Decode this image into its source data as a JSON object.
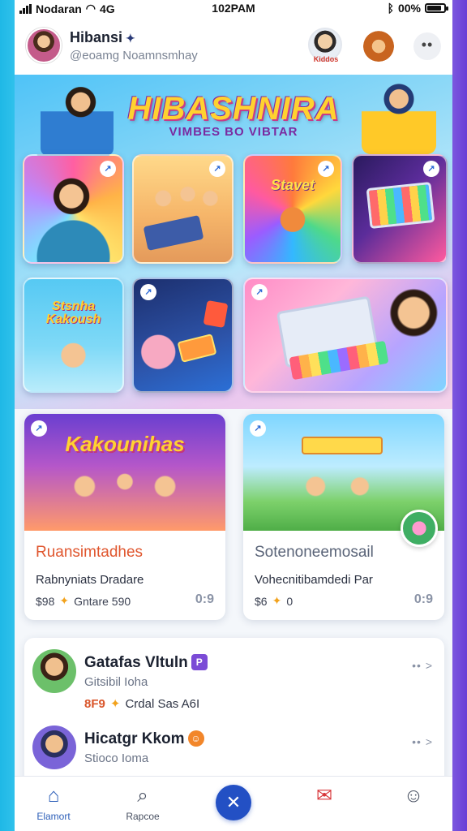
{
  "status_bar": {
    "carrier": "Nodaran",
    "network": "4G",
    "time": "102PAM",
    "battery": "00%",
    "battery_level": 0.85
  },
  "header": {
    "profile_name": "Hibansi",
    "verified_icon": "verified-icon",
    "handle": "@eoamg Noamnsmhay",
    "buddy_tag": "Kiddos",
    "more_label": "••"
  },
  "hero": {
    "title": "HIBASHNIRA",
    "subtitle": "VIMBES BO VIBTAR",
    "tiles": [
      {
        "label": ""
      },
      {
        "label": ""
      },
      {
        "label": "Stavet"
      },
      {
        "label": ""
      },
      {
        "label": "Stsnha Kakoush"
      },
      {
        "label": ""
      },
      {
        "label": ""
      }
    ]
  },
  "feature_cards": [
    {
      "image_title": "Kakounihas",
      "title": "Ruansimtadhes",
      "subtitle": "Rabnyniats Dradare",
      "meta_left": "$98",
      "meta_right": "Gntare 590",
      "share": "0:9",
      "accent": "#e0562e"
    },
    {
      "image_title": "",
      "title": "Sotenoneemosail",
      "subtitle": "Vohecnitibamdedi Par",
      "meta_left": "$6",
      "meta_right": "0",
      "share": "0:9",
      "accent": "#5a6478"
    }
  ],
  "activity": [
    {
      "name": "Gatafas Vltuln",
      "badge": "P",
      "sub": "Gitsibil Ioha",
      "stat_num": "8F9",
      "stat_text": "Crdal Sas A6I",
      "more": "•• >"
    },
    {
      "name": "Hicatgr Kkom",
      "badge": "☺",
      "sub": "Stioco Ioma",
      "stat_num": "",
      "stat_text": "",
      "more": "•• >"
    }
  ],
  "bottom_nav": [
    {
      "label": "Elamort",
      "icon": "home-icon",
      "glyph": "⌂"
    },
    {
      "label": "Rapcoe",
      "icon": "search-icon",
      "glyph": "⌕"
    },
    {
      "label": "",
      "icon": "create-icon",
      "glyph": "✕"
    },
    {
      "label": "",
      "icon": "notifications-icon",
      "glyph": "✉"
    },
    {
      "label": "",
      "icon": "profile-icon",
      "glyph": "☺"
    }
  ],
  "colors": {
    "accent": "#2350c4",
    "hero_title": "#ffd230",
    "header_bg": "#ffffff"
  }
}
